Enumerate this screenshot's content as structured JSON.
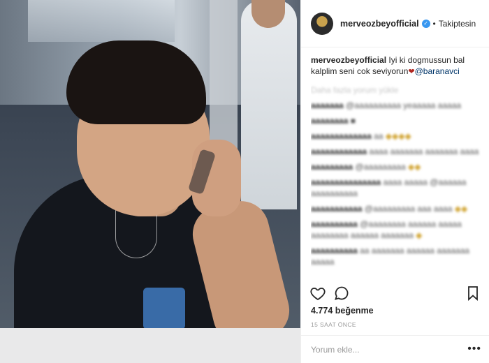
{
  "post": {
    "username": "merveozbeyofficial",
    "follow_status": "Takiptesin",
    "dot": "•",
    "caption_user": "merveozbeyofficial",
    "caption_text": " Iyi ki dogmussun bal kalplim seni cok seviyorun",
    "caption_heart": "❤",
    "caption_mention": "@baranavci",
    "load_more": "Daha fazla yorum yükle",
    "likes": "4.774 beğenme",
    "time": "15 SAAT ÖNCE",
    "comment_placeholder": "Yorum ekle...",
    "more": "•••"
  },
  "comments": [
    {
      "user": "aaaaaaa",
      "text": " @aaaaaaaaaa yeaaaaa aaaaa",
      "extra": ""
    },
    {
      "user": "aaaaaaaa",
      "text": " ■",
      "extra": ""
    },
    {
      "user": "aaaaaaaaaaaaa",
      "text": " aa",
      "extra": " ◆◆◆◆"
    },
    {
      "user": "aaaaaaaaaaaa",
      "text": " aaaa aaaaaaa aaaaaaa aaaa",
      "extra": ""
    },
    {
      "user": "aaaaaaaaa",
      "text": " @aaaaaaaaa",
      "extra": " ◆◆"
    },
    {
      "user": "aaaaaaaaaaaaaaa",
      "text": " aaaa aaaaa @aaaaaa aaaaaaaaaa",
      "extra": ""
    },
    {
      "user": "aaaaaaaaaaa",
      "text": " @aaaaaaaaa aaa aaaa",
      "extra": " ◆◆"
    },
    {
      "user": "aaaaaaaaaa",
      "text": " @aaaaaaaa aaaaaa aaaaa aaaaaaaa aaaaaa aaaaaaa",
      "extra": " ◆"
    },
    {
      "user": "aaaaaaaaaa",
      "text": " aa aaaaaaa aaaaaa aaaaaaa aaaaa",
      "extra": ""
    }
  ],
  "icons": {
    "heart": "heart-icon",
    "comment": "comment-icon",
    "bookmark": "bookmark-icon",
    "verified": "verified-badge-icon"
  }
}
